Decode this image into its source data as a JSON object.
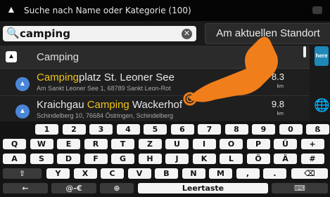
{
  "status": {
    "title": "Suche nach Name oder Kategorie (100)"
  },
  "search": {
    "value": "camping",
    "standort_label": "Am aktuellen Standort"
  },
  "category": {
    "label": "Camping"
  },
  "results": [
    {
      "name_hl": "Camping",
      "name_rest": "platz St. Leoner See",
      "addr": "Am Sankt Leoner See 1, 68789 Sankt Leon-Rot",
      "dist": "8.3",
      "unit": "km"
    },
    {
      "name_pre": "Kraichgau ",
      "name_hl": "Camping",
      "name_rest": " Wackerhof",
      "addr": "Schindelberg 10, 76684 Östringen, Schindelberg",
      "dist": "9.8",
      "unit": "km"
    }
  ],
  "side": {
    "here": "here"
  },
  "keyboard": {
    "row1": [
      "1",
      "2",
      "3",
      "4",
      "5",
      "6",
      "7",
      "8",
      "9",
      "0",
      "ß"
    ],
    "row2": [
      "Q",
      "W",
      "E",
      "R",
      "T",
      "Z",
      "U",
      "I",
      "O",
      "P",
      "Ü",
      "+"
    ],
    "row3": [
      "A",
      "S",
      "D",
      "F",
      "G",
      "H",
      "J",
      "K",
      "L",
      "Ö",
      "Ä",
      "#"
    ],
    "row4": [
      "Y",
      "X",
      "C",
      "V",
      "B",
      "N",
      "M",
      ",",
      "."
    ],
    "alt": "@-€",
    "space": "Leertaste"
  }
}
